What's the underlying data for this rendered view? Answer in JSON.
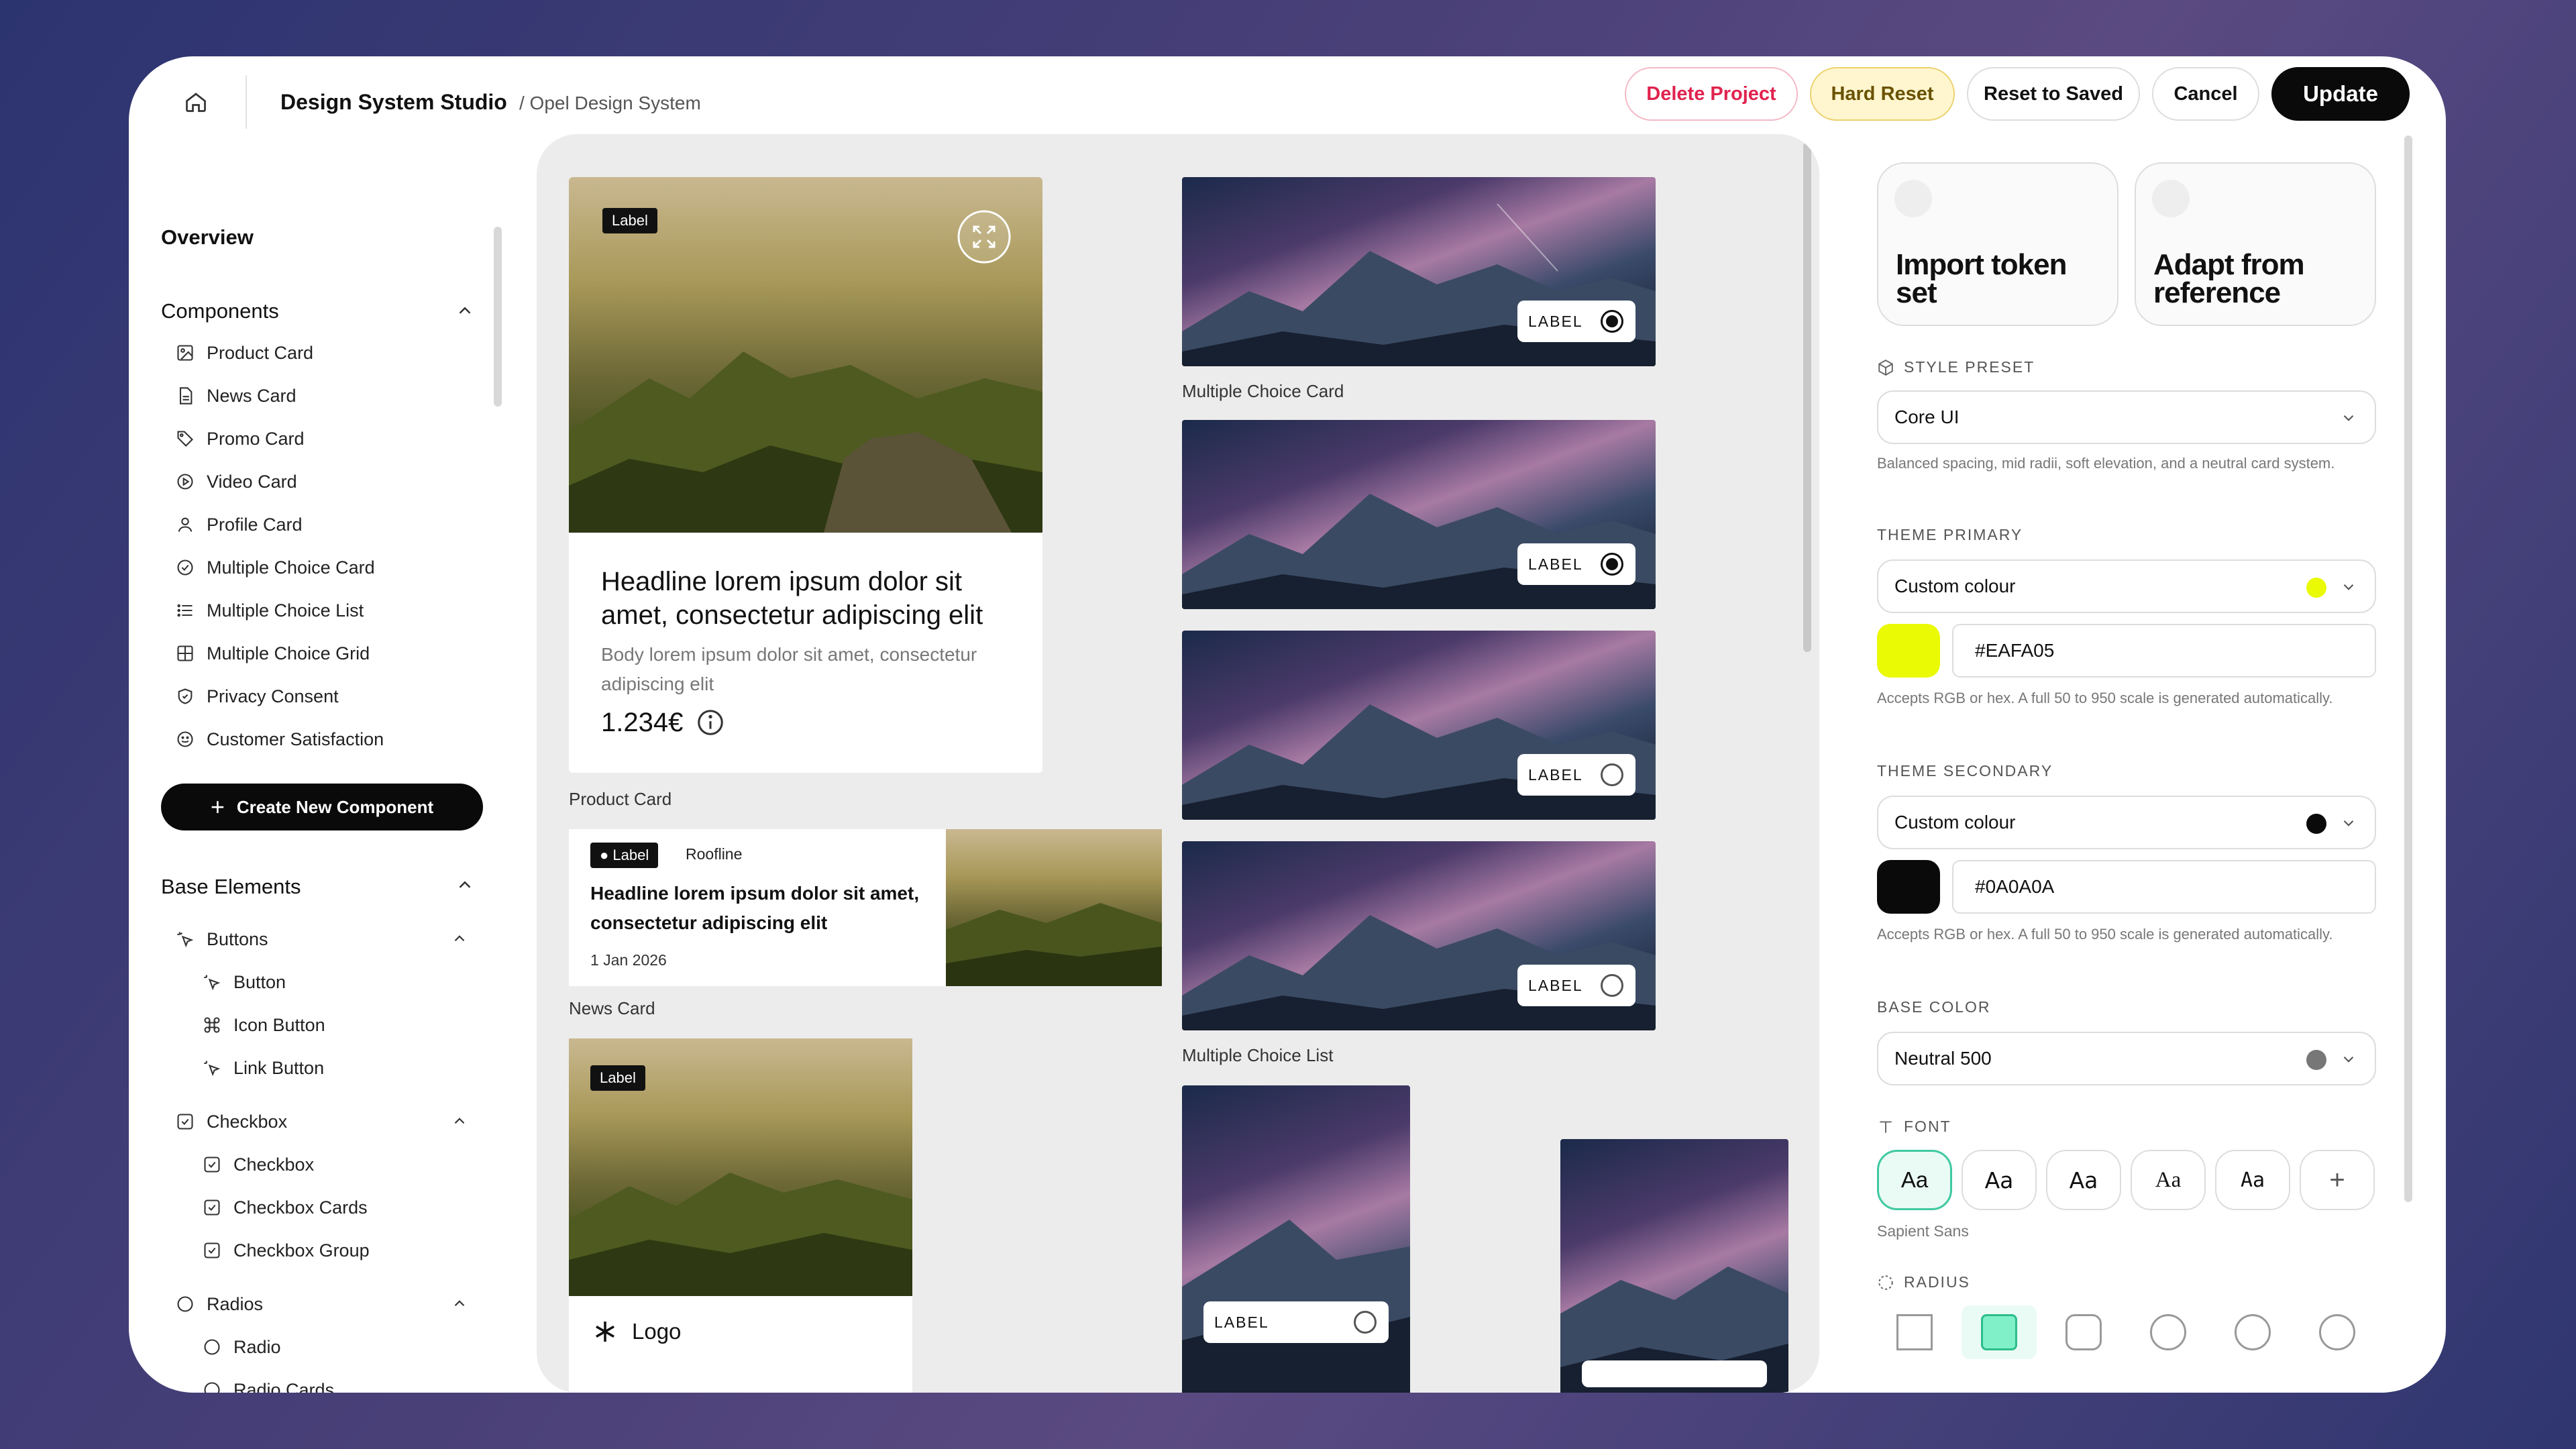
{
  "header": {
    "title": "Design System Studio",
    "breadcrumb": "/ Opel Design System",
    "buttons": {
      "delete": "Delete Project",
      "hard_reset": "Hard Reset",
      "reset_saved": "Reset to Saved",
      "cancel": "Cancel",
      "update": "Update"
    }
  },
  "sidebar": {
    "overview": "Overview",
    "components_title": "Components",
    "components": [
      "Product Card",
      "News Card",
      "Promo Card",
      "Video Card",
      "Profile Card",
      "Multiple Choice Card",
      "Multiple Choice List",
      "Multiple Choice Grid",
      "Privacy Consent",
      "Customer Satisfaction"
    ],
    "create_label": "Create New Component",
    "base_title": "Base Elements",
    "buttons_group": "Buttons",
    "button_items": [
      "Button",
      "Icon Button",
      "Link Button"
    ],
    "checkbox_group": "Checkbox",
    "checkbox_items": [
      "Checkbox",
      "Checkbox Cards",
      "Checkbox Group"
    ],
    "radios_group": "Radios",
    "radio_items": [
      "Radio",
      "Radio Cards"
    ]
  },
  "canvas": {
    "product": {
      "tag": "Label",
      "headline": "Headline lorem ipsum dolor sit amet, consectetur adipiscing elit",
      "body": "Body lorem ipsum dolor sit amet, consectetur adipiscing elit",
      "price": "1.234€",
      "caption": "Product Card"
    },
    "news": {
      "tag": "Label",
      "roofline": "Roofline",
      "headline": "Headline lorem ipsum dolor sit amet, consectetur adipiscing elit",
      "date": "1 Jan 2026",
      "caption": "News Card"
    },
    "promo": {
      "tag": "Label",
      "logo": "Logo"
    },
    "mc_card": {
      "label": "LABEL",
      "caption": "Multiple Choice Card"
    },
    "mc_list": {
      "items": [
        "LABEL",
        "LABEL",
        "LABEL"
      ],
      "caption": "Multiple Choice List"
    },
    "mc_grid": {
      "label": "LABEL"
    }
  },
  "panel": {
    "import": "Import token set",
    "adapt": "Adapt from reference",
    "style_preset_label": "STYLE PRESET",
    "style_preset_value": "Core UI",
    "style_preset_hint": "Balanced spacing, mid radii, soft elevation, and a neutral card system.",
    "primary_label": "THEME PRIMARY",
    "primary_value": "Custom colour",
    "primary_hex": "#EAFA05",
    "primary_color": "#EAFA05",
    "hint_scale": "Accepts RGB or hex. A full 50 to 950 scale is generated automatically.",
    "secondary_label": "THEME SECONDARY",
    "secondary_value": "Custom colour",
    "secondary_hex": "#0A0A0A",
    "secondary_color": "#0A0A0A",
    "base_label": "BASE COLOR",
    "base_value": "Neutral 500",
    "base_color": "#777777",
    "font_label": "FONT",
    "font_samples": [
      "Aa",
      "Aa",
      "Aa",
      "Aa",
      "Aa",
      "+"
    ],
    "font_name": "Sapient Sans",
    "radius_label": "RADIUS"
  }
}
